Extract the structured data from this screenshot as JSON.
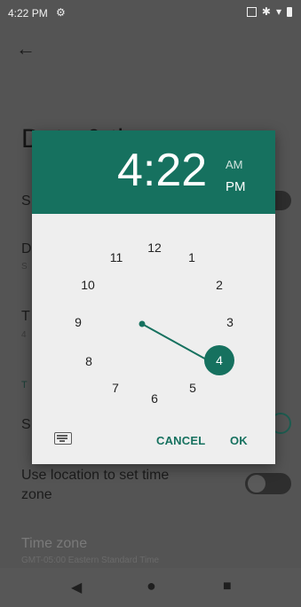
{
  "status_bar": {
    "time": "4:22 PM",
    "icons": [
      "gear-icon",
      "screenshot-icon",
      "bluetooth-icon",
      "wifi-icon",
      "battery-icon"
    ]
  },
  "background": {
    "title": "Date & time",
    "rows": [
      {
        "label": "S"
      },
      {
        "label": "D",
        "sub": "S"
      },
      {
        "label": "T",
        "sub": "4"
      },
      {
        "label": "T"
      },
      {
        "label": "S"
      },
      {
        "label": "Use location to set time\nzone"
      },
      {
        "label": "Time zone",
        "sub": "GMT-05:00 Eastern Standard Time"
      }
    ]
  },
  "dialog": {
    "hour": "4",
    "minute": "22",
    "am_label": "AM",
    "pm_label": "PM",
    "selected_period": "PM",
    "selected_number": "4",
    "numbers": [
      "12",
      "1",
      "2",
      "3",
      "4",
      "5",
      "6",
      "7",
      "8",
      "9",
      "10",
      "11"
    ],
    "cancel_label": "CANCEL",
    "ok_label": "OK"
  },
  "colors": {
    "accent": "#16715f"
  }
}
